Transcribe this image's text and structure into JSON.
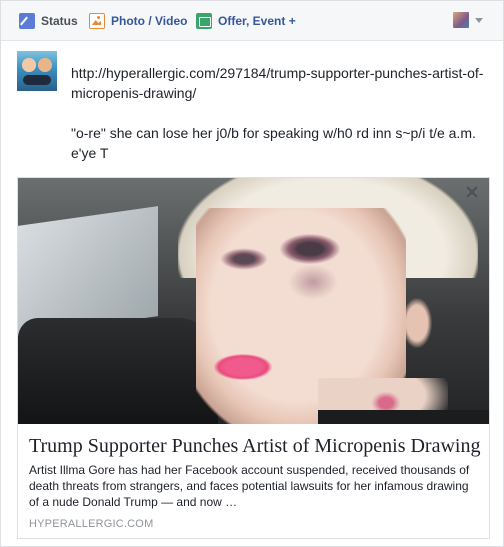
{
  "tabs": [
    {
      "label": "Status",
      "icon": "pencil-icon"
    },
    {
      "label": "Photo / Video",
      "icon": "photo-icon"
    },
    {
      "label": "Offer, Event +",
      "icon": "offer-icon"
    }
  ],
  "post": {
    "text": "http://hyperallergic.com/297184/trump-supporter-punches-artist-of-micropenis-drawing/\n\n\"o-re\" she can lose her j0/b for speaking w/h0 rd inn s~p/i t/e a.m. e'ye T"
  },
  "link_preview": {
    "title": "Trump Supporter Punches Artist of Micropenis Drawing",
    "description": "Artist Illma Gore has had her Facebook account suspended, received thousands of death threats from strangers, and faces potential lawsuits for her infamous drawing of a nude Donald Trump — and now …",
    "domain": "HYPERALLERGIC.COM"
  },
  "colors": {
    "tab_active": "#4b4f56",
    "tab_link": "#365899",
    "status_icon": "#5b7bd5",
    "photo_icon": "#e58a3b",
    "offer_icon": "#3aa56a",
    "lipstick": "#f05a8c"
  }
}
